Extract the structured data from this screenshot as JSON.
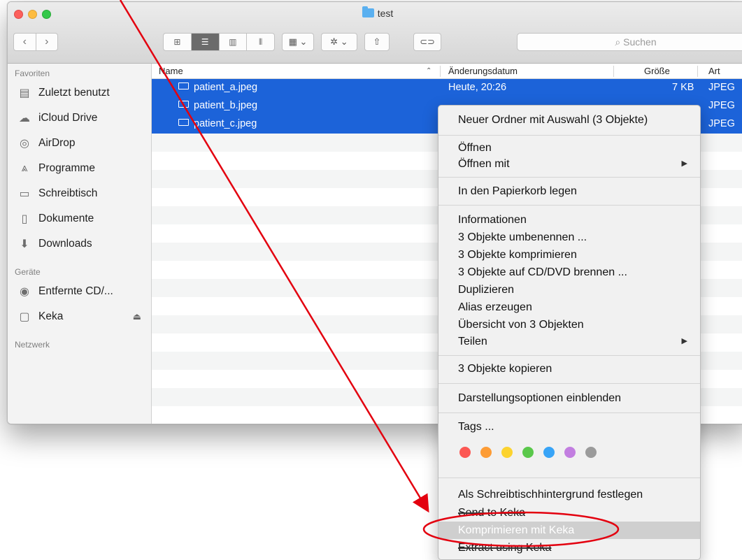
{
  "window": {
    "title": "test",
    "search_placeholder": "Suchen"
  },
  "toolbar": {
    "back": "‹",
    "forward": "›"
  },
  "sidebar": {
    "favorites_header": "Favoriten",
    "favorites": [
      {
        "label": "Zuletzt benutzt",
        "icon": "recents-icon"
      },
      {
        "label": "iCloud Drive",
        "icon": "cloud-icon"
      },
      {
        "label": "AirDrop",
        "icon": "airdrop-icon"
      },
      {
        "label": "Programme",
        "icon": "applications-icon"
      },
      {
        "label": "Schreibtisch",
        "icon": "desktop-icon"
      },
      {
        "label": "Dokumente",
        "icon": "documents-icon"
      },
      {
        "label": "Downloads",
        "icon": "downloads-icon"
      }
    ],
    "devices_header": "Geräte",
    "devices": [
      {
        "label": "Entfernte CD/...",
        "icon": "disc-icon"
      },
      {
        "label": "Keka",
        "icon": "drive-icon"
      }
    ],
    "network_header": "Netzwerk"
  },
  "columns": {
    "name": "Name",
    "date": "Änderungsdatum",
    "size": "Größe",
    "kind": "Art"
  },
  "files": [
    {
      "name": "patient_a.jpeg",
      "date": "Heute, 20:26",
      "size": "7 KB",
      "kind": "JPEG"
    },
    {
      "name": "patient_b.jpeg",
      "date": "",
      "size": "",
      "kind": "JPEG"
    },
    {
      "name": "patient_c.jpeg",
      "date": "",
      "size": "",
      "kind": "JPEG"
    }
  ],
  "context_menu": {
    "new_folder": "Neuer Ordner mit Auswahl (3 Objekte)",
    "open": "Öffnen",
    "open_with": "Öffnen mit",
    "trash": "In den Papierkorb legen",
    "info": "Informationen",
    "rename": "3 Objekte umbenennen ...",
    "compress": "3 Objekte komprimieren",
    "burn": "3 Objekte auf CD/DVD brennen ...",
    "duplicate": "Duplizieren",
    "alias": "Alias erzeugen",
    "overview": "Übersicht von 3 Objekten",
    "share": "Teilen",
    "copy": "3 Objekte kopieren",
    "view_options": "Darstellungsoptionen einblenden",
    "tags": "Tags ...",
    "tag_colors": [
      "#fc5753",
      "#fd9c35",
      "#fcd32f",
      "#5ac84b",
      "#38a4f7",
      "#c27ee0",
      "#9b9b9b"
    ],
    "set_wallpaper": "Als Schreibtischhintergrund festlegen",
    "send_to_keka": "Send to Keka",
    "compress_keka": "Komprimieren mit Keka",
    "extract_keka": "Extract using Keka"
  },
  "annotation_color": "#e3000f"
}
